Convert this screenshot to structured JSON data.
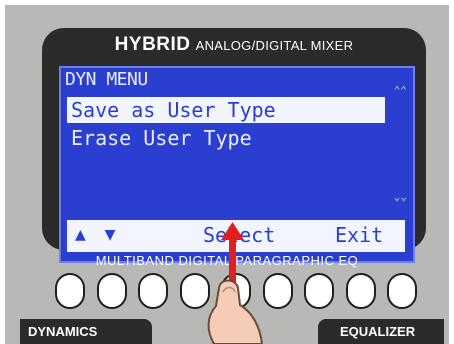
{
  "device": {
    "brand_bold": "HYBRID",
    "brand_rest": "ANALOG/DIGITAL MIXER",
    "section_label": "MULTIBAND DIGITAL PARAGRAPHIC EQ",
    "tab_left": "DYNAMICS",
    "tab_right": "EQUALIZER",
    "knob_count": 9
  },
  "lcd": {
    "menu_title": "DYN MENU",
    "items": [
      {
        "label": "Save as User Type",
        "selected": true
      },
      {
        "label": "Erase User Type",
        "selected": false
      }
    ],
    "softkeys": {
      "nav_arrows": "▲ ▼",
      "select": "Select",
      "exit": "Exit"
    }
  },
  "colors": {
    "lcd_background": "#2a3fcf",
    "lcd_highlight": "#f2f4ff",
    "bezel": "#2b2b2b",
    "panel": "#b8b8b6",
    "indicator_arrow": "#e02020"
  },
  "icons": {
    "pointer": "hand-pointer-icon",
    "indicator": "red-up-arrow-icon"
  }
}
